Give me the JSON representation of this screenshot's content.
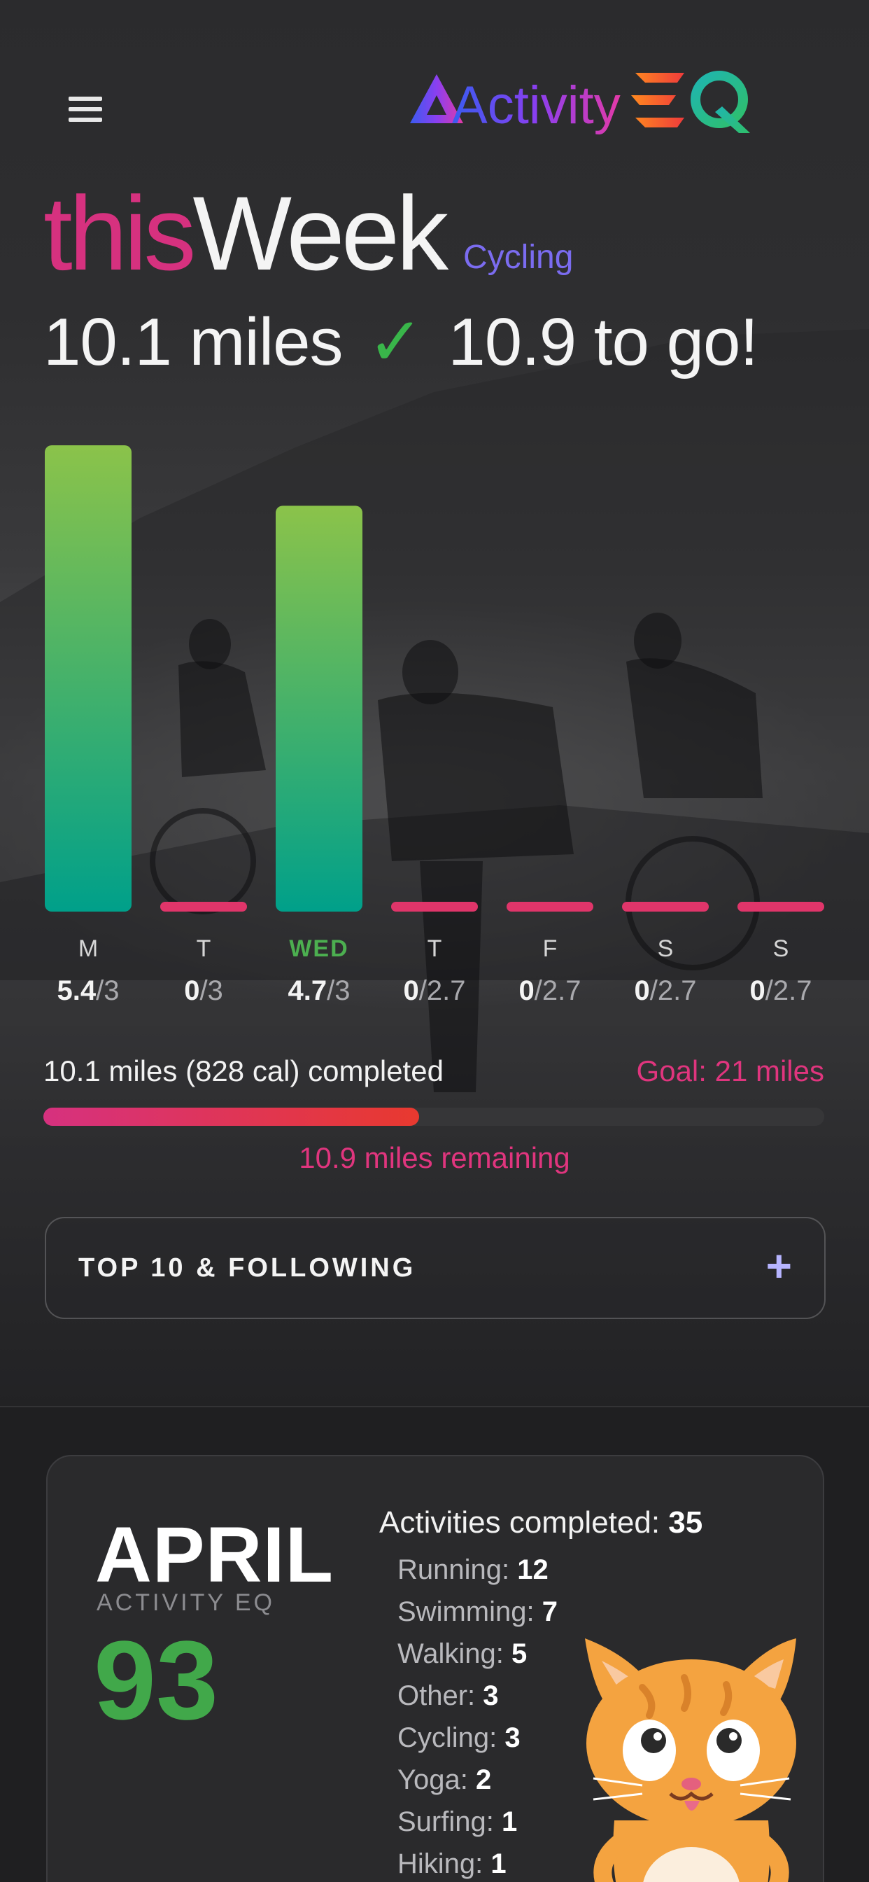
{
  "app": {
    "logo_text_1": "Activity",
    "logo_text_2": "EQ"
  },
  "week": {
    "title_this": "this",
    "title_week": "Week",
    "activity": "Cycling",
    "done": "10.1 miles",
    "check": "✓",
    "to_go": "10.9 to go!"
  },
  "chart_data": {
    "type": "bar",
    "categories": [
      "M",
      "T",
      "WED",
      "T",
      "F",
      "S",
      "S"
    ],
    "values": [
      5.4,
      0,
      4.7,
      0,
      0,
      0,
      0
    ],
    "goals": [
      3,
      3,
      3,
      2.7,
      2.7,
      2.7,
      2.7
    ],
    "value_labels": [
      "5.4",
      "0",
      "4.7",
      "0",
      "0",
      "0",
      "0"
    ],
    "goal_labels": [
      "/3",
      "/3",
      "/3",
      "/2.7",
      "/2.7",
      "/2.7",
      "/2.7"
    ],
    "highlight_index": 2,
    "ylim": [
      0,
      5.4
    ],
    "colors": {
      "bar_top": "#8bc34a",
      "bar_bottom": "#00a08a",
      "empty": "#e0356a",
      "highlight": "#4caf50"
    }
  },
  "progress": {
    "completed": "10.1 miles (828 cal) completed",
    "goal": "Goal: 21 miles",
    "fraction": 0.481,
    "remaining": "10.9 miles remaining"
  },
  "top10": {
    "label": "TOP 10 & FOLLOWING",
    "icon": "plus-icon",
    "plus": "+"
  },
  "month": {
    "name": "APRIL",
    "sub": "ACTIVITY EQ",
    "score": "93",
    "total_label": "Activities completed:",
    "total_value": "35",
    "activities": [
      {
        "label": "Running:",
        "value": "12"
      },
      {
        "label": "Swimming:",
        "value": "7"
      },
      {
        "label": "Walking:",
        "value": "5"
      },
      {
        "label": "Other:",
        "value": "3"
      },
      {
        "label": "Cycling:",
        "value": "3"
      },
      {
        "label": "Yoga:",
        "value": "2"
      },
      {
        "label": "Surfing:",
        "value": "1"
      },
      {
        "label": "Hiking:",
        "value": "1"
      }
    ]
  }
}
